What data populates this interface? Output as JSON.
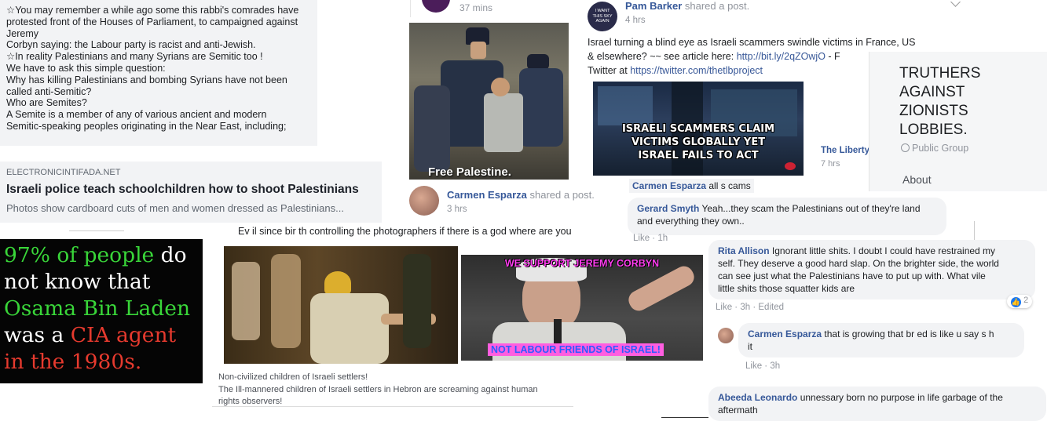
{
  "rabbi_post": {
    "lines": [
      "☆You may remember a while ago some this rabbi's comrades have",
      "protested front of the Houses of Parliament, to campaigned against",
      "Jeremy",
      "Corbyn saying: the Labour party is racist and anti-Jewish.",
      "☆In reality Palestinians and many Syrians are Semitic too !",
      "We have to ask this simple question:",
      "Why has killing Palestinians and bombing Syrians have not been",
      "called anti-Semitic?",
      "Who are Semites?",
      "A Semite is a member of any of various ancient and modern",
      "Semitic-speaking peoples originating in the Near East, including;"
    ]
  },
  "ei_link": {
    "domain": "ELECTRONICINTIFADA.NET",
    "title": "Israeli police teach schoolchildren how to shoot Palestinians",
    "desc": "Photos show cardboard cuts of men and women dressed as Palestinians..."
  },
  "cia_meme": {
    "line1_a": "97% of people",
    "line1_b": " do",
    "line2": "not know that",
    "line3": "Osama Bin Laden",
    "line4_a": "was a ",
    "line4_b": "CIA agent",
    "line5": "in the 1980s.",
    "colors": {
      "green": "#39d639",
      "red": "#e63a2e",
      "white": "#ffffff",
      "bg": "#050505"
    }
  },
  "top_mid": {
    "time": "37 mins"
  },
  "free_palestine": {
    "caption": "Free Palestine."
  },
  "carmen_share": {
    "name": "Carmen Esparza",
    "action": " shared a post.",
    "time": "3 hrs"
  },
  "god_text": {
    "text": "Ev il since bir th controlling the photographers if there is a god where are you"
  },
  "settlers": {
    "line1": "Non-civilized children of Israeli settlers!",
    "line2": "The Ill-mannered children of Israeli settlers in Hebron are screaming against human",
    "line3": "rights observers!"
  },
  "corbyn": {
    "top": "WE SUPPORT JEREMY CORBYN",
    "bottom": "NOT LABOUR FRIENDS OF ISRAEL!"
  },
  "pam_post": {
    "avatar_text": "I WANT THIS SKY AGAIN",
    "name": "Pam Barker",
    "action": " shared a post.",
    "time": "4 hrs",
    "text1": "Israel turning a blind eye as Israeli scammers swindle victims in France, US",
    "text2_a": "& elsewhere? ~~ see article here: ",
    "link1": "http://bit.ly/2qZOwjO",
    "text2_b": " - F",
    "text3_a": "Twitter at ",
    "link2": "https://twitter.com/thetlbproject"
  },
  "scam_image": {
    "line1": "ISRAELI SCAMMERS CLAIM",
    "line2": "VICTIMS GLOBALLY YET",
    "line3": "ISRAEL FAILS TO ACT"
  },
  "liberty": {
    "name": "The Liberty",
    "time": "7 hrs"
  },
  "truthers": {
    "title_lines": [
      "TRUTHERS",
      "AGAINST",
      "ZIONISTS",
      "LOBBIES."
    ],
    "type": "Public Group",
    "about": "About"
  },
  "comments": {
    "c0": {
      "name": "Carmen Esparza",
      "text": " all s cams"
    },
    "c1": {
      "name": "Gerard Smyth",
      "text": " Yeah...they scam the Palestinians out of they're land",
      "text2": "and everything they own..",
      "like": "Like",
      "time": "1h"
    },
    "c2": {
      "name": "Rita Allison",
      "text": " Ignorant little shits. I doubt I could have restrained my",
      "lines": [
        "self. They deserve a good hard slap. On the brighter side, the world",
        "can see just what the Palestinians have to put up with. What vile",
        "little shits those squatter kids are"
      ],
      "like": "Like",
      "time": "3h",
      "edited": "Edited",
      "reactions": "2"
    },
    "c3": {
      "name": "Carmen Esparza",
      "text": " that is growing that br ed is like u say s h",
      "text2": "it",
      "like": "Like",
      "time": "3h"
    },
    "c4": {
      "name": "Abeeda Leonardo",
      "text": " unnessary born no purpose in life garbage of the",
      "text2": "aftermath"
    }
  }
}
